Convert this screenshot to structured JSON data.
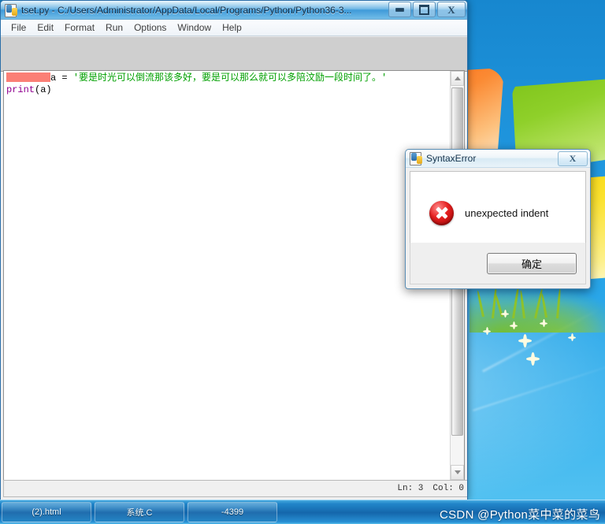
{
  "desktop": {
    "wallpaper_name": "windows-7-harmony",
    "sky_color": "#1f95dd"
  },
  "idle_window": {
    "icon": "python-idle-icon",
    "title": "tset.py - C:/Users/Administrator/AppData/Local/Programs/Python/Python36-3...",
    "controls": {
      "minimize": "minimize-icon",
      "maximize": "maximize-icon",
      "close": "X"
    },
    "menu": [
      {
        "label": "File"
      },
      {
        "label": "Edit"
      },
      {
        "label": "Format"
      },
      {
        "label": "Run"
      },
      {
        "label": "Options"
      },
      {
        "label": "Window"
      },
      {
        "label": "Help"
      }
    ],
    "code": {
      "line1_indent_marker": "",
      "line1_code": "a = ",
      "line1_string": "'要是时光可以倒流那该多好，要是可以那么就可以多陪汶励一段时间了。'",
      "line2_keyword": "print",
      "line2_args": "(a)",
      "error_highlight_color": "#fb7f76",
      "string_color": "#00a000",
      "keyword_color": "#900090"
    },
    "statusbar": {
      "line": "Ln: 3",
      "column": "Col: 0"
    },
    "scrollbar": {
      "up_arrow": "scroll-up-icon",
      "down_arrow": "scroll-down-icon"
    }
  },
  "error_dialog": {
    "icon": "python-idle-icon",
    "title": "SyntaxError",
    "close_label": "X",
    "error_icon": "error-x-icon",
    "message": "unexpected indent",
    "ok_button": "确定",
    "accent_color": "#e62121"
  },
  "taskbar": {
    "items": [
      {
        "label": "(2).html"
      },
      {
        "label": "系统.C"
      },
      {
        "label": "-4399"
      }
    ]
  },
  "watermark": "CSDN @Python菜中菜的菜鸟"
}
